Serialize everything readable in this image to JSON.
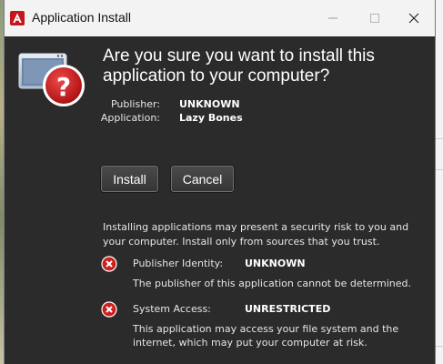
{
  "window": {
    "title": "Application Install",
    "controls": {
      "minimize": "minimize",
      "maximize": "maximize",
      "close": "close"
    }
  },
  "dialog": {
    "headline": "Are you sure you want to install this application to your computer?",
    "publisher_label": "Publisher:",
    "publisher_value": "UNKNOWN",
    "application_label": "Application:",
    "application_value": "Lazy Bones",
    "install_label": "Install",
    "cancel_label": "Cancel",
    "warning_text": "Installing applications may present a security risk to you and your computer. Install only from sources that you trust.",
    "risks": [
      {
        "label": "Publisher Identity:",
        "value": "UNKNOWN",
        "description": "The publisher of this application cannot be determined."
      },
      {
        "label": "System Access:",
        "value": "UNRESTRICTED",
        "description": "This application may access your file system and the internet, which may put your computer at risk."
      }
    ]
  },
  "colors": {
    "dialog_background": "#2b2b2b",
    "titlebar_background": "#f3f3f3",
    "app_logo": "#c4161c",
    "error_red": "#cc1f1f",
    "question_red": "#d01919"
  },
  "icons": {
    "app_logo": "adobe-air-logo-icon",
    "dialog": "question-window-icon",
    "risk": "error-x-icon"
  }
}
